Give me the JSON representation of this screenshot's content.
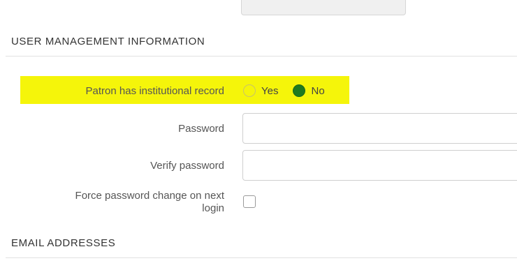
{
  "sections": {
    "user_management": {
      "title": "USER MANAGEMENT INFORMATION"
    },
    "email": {
      "title": "EMAIL ADDRESSES"
    }
  },
  "institutional_record": {
    "label": "Patron has institutional record",
    "options": [
      {
        "label": "Yes",
        "selected": false
      },
      {
        "label": "No",
        "selected": true
      }
    ],
    "highlight_color": "#f5f50a",
    "selected_color": "#1f7a1f"
  },
  "password": {
    "label": "Password",
    "value": ""
  },
  "verify_password": {
    "label": "Verify password",
    "value": ""
  },
  "force_change": {
    "label_line1": "Force password change on next",
    "label_line2": "login",
    "checked": false
  }
}
